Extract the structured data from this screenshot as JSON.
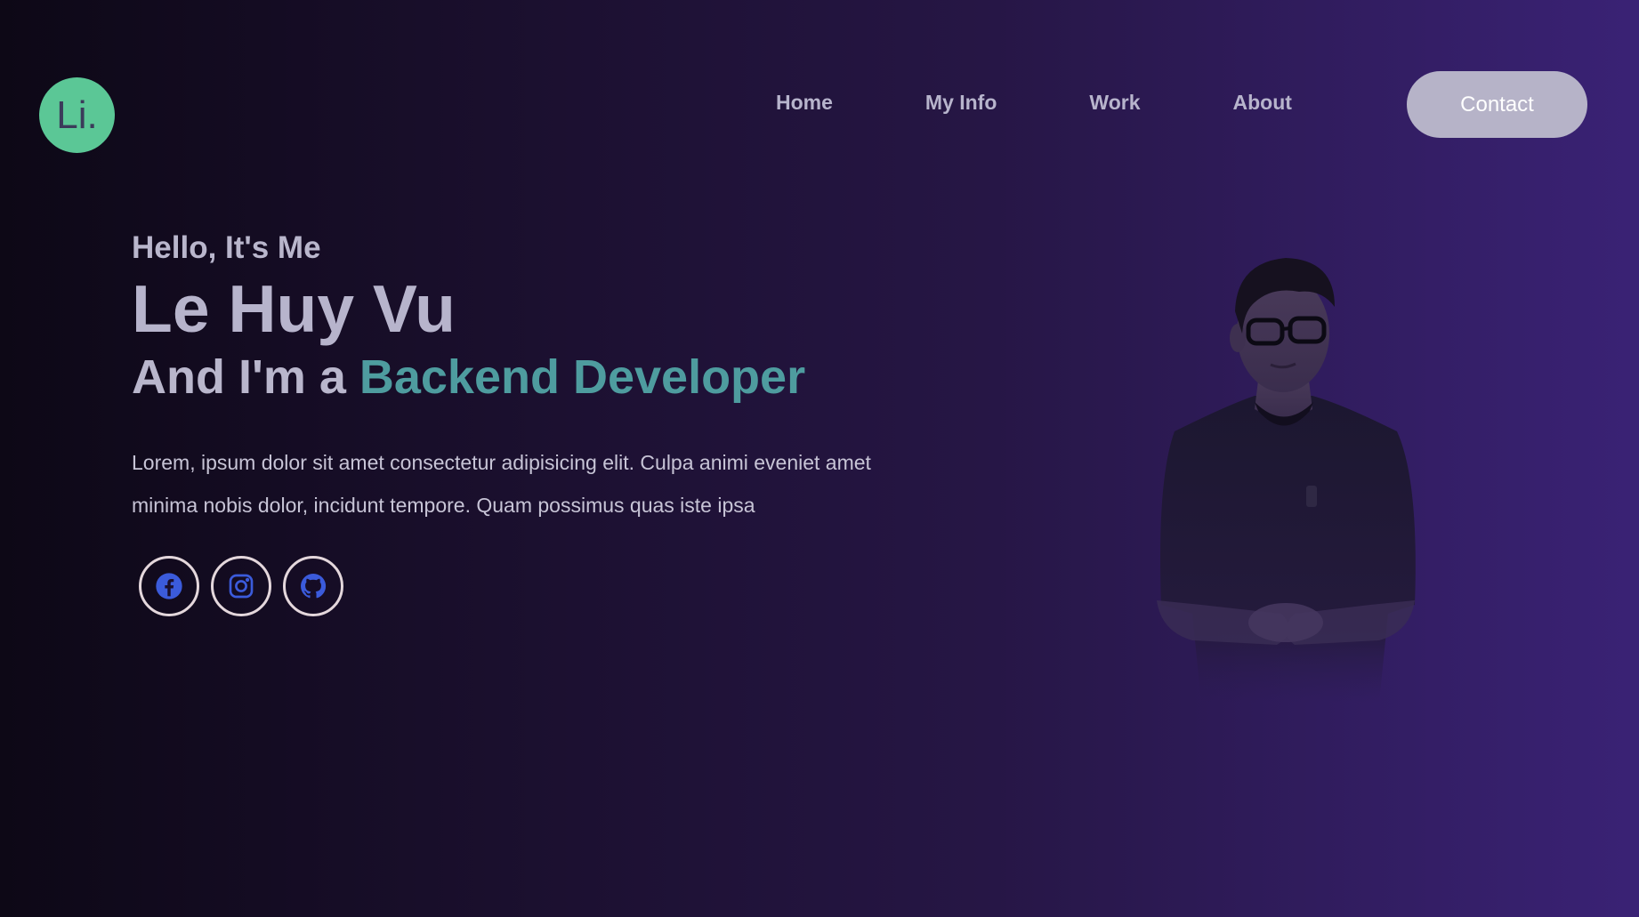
{
  "logo": {
    "text": "Li."
  },
  "nav": {
    "items": [
      {
        "label": "Home"
      },
      {
        "label": "My Info"
      },
      {
        "label": "Work"
      },
      {
        "label": "About"
      }
    ],
    "contact_label": "Contact"
  },
  "hero": {
    "greeting": "Hello, It's Me",
    "name": "Le Huy Vu",
    "role_prefix": "And I'm a ",
    "role": "Backend Developer",
    "description": "Lorem, ipsum dolor sit amet consectetur adipisicing elit. Culpa animi eveniet amet minima nobis dolor, incidunt tempore. Quam possimus quas iste ipsa"
  },
  "socials": [
    {
      "icon": "facebook-icon"
    },
    {
      "icon": "instagram-icon"
    },
    {
      "icon": "github-icon"
    }
  ],
  "colors": {
    "accent": "#4e9c9f",
    "logo_bg": "#5bc796",
    "social_icon": "#3b5bdb",
    "contact_bg": "#b6b3c8"
  }
}
